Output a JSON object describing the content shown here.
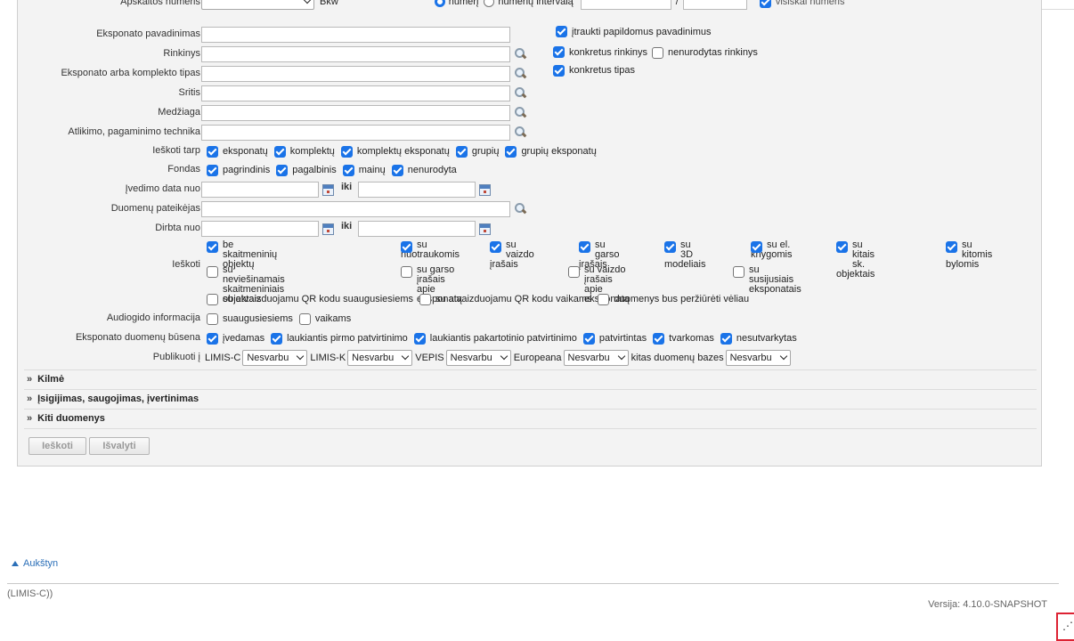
{
  "top_row": {
    "label": "Apskaitos numeris",
    "select_value": "Bkw",
    "radio1": "numerį",
    "radio2": "numerių intervalą",
    "sep": "/",
    "extra": "visiškai numeris"
  },
  "fields": {
    "name": {
      "label": "Eksponato pavadinimas",
      "opt": "įtraukti papildomus pavadinimus"
    },
    "collections": {
      "label": "Rinkinys",
      "opt1": "konkretus rinkinys",
      "opt2": "nenurodytas rinkinys"
    },
    "type": {
      "label": "Eksponato arba komplekto tipas",
      "opt": "konkretus tipas"
    },
    "field": {
      "label": "Sritis"
    },
    "material": {
      "label": "Medžiaga"
    },
    "technique": {
      "label": "Atlikimo, pagaminimo technika"
    }
  },
  "search_among": {
    "label": "Ieškoti tarp",
    "items": [
      "eksponatų",
      "komplektų",
      "komplektų eksponatų",
      "grupių",
      "grupių eksponatų"
    ]
  },
  "fund": {
    "label": "Fondas",
    "items": [
      "pagrindinis",
      "pagalbinis",
      "mainų",
      "nenurodyta"
    ]
  },
  "entry_date": {
    "label": "Įvedimo data nuo",
    "iki": "iki"
  },
  "provider": {
    "label": "Duomenų pateikėjas"
  },
  "made_from": {
    "label": "Dirbta nuo",
    "iki": "iki"
  },
  "search": {
    "label": "Ieškoti",
    "row1": [
      {
        "l1": "be skaitmeninių objektų",
        "l2": "",
        "on": true
      },
      {
        "l1": "su",
        "l2": "nuotraukomis",
        "on": true
      },
      {
        "l1": "su vaizdo",
        "l2": "įrašais",
        "on": true
      },
      {
        "l1": "su garso",
        "l2": "įrašais",
        "on": true
      },
      {
        "l1": "su 3D",
        "l2": "modeliais",
        "on": true
      },
      {
        "l1": "su el.",
        "l2": "knygomis",
        "on": true
      },
      {
        "l1": "su kitais sk.",
        "l2": "objektais",
        "on": true
      },
      {
        "l1": "su kitomis",
        "l2": "bylomis",
        "on": true
      }
    ],
    "row2": [
      {
        "l1": "su neviešinamais skaitmeniniais",
        "l2": "objektais"
      },
      {
        "l1": "su garso įrašais apie eksponatą",
        "l2": ""
      },
      {
        "l1": "su vaizdo įrašais apie eksponatą",
        "l2": ""
      },
      {
        "l1": "su susijusiais eksponatais",
        "l2": ""
      }
    ],
    "row3": [
      "su atvaizduojamu QR kodu suaugusiesiems",
      "su atvaizduojamu QR kodu vaikams",
      "duomenys bus peržiūrėti vėliau"
    ]
  },
  "audioguide": {
    "label": "Audiogido informacija",
    "items": [
      "suaugusiesiems",
      "vaikams"
    ]
  },
  "status": {
    "label": "Eksponato duomenų būsena",
    "items": [
      "įvedamas",
      "laukiantis pirmo patvirtinimo",
      "laukiantis pakartotinio patvirtinimo",
      "patvirtintas",
      "tvarkomas",
      "nesutvarkytas"
    ]
  },
  "publish": {
    "label": "Publikuoti į",
    "targets": [
      {
        "name": "LIMIS-C",
        "value": "Nesvarbu"
      },
      {
        "name": "LIMIS-K",
        "value": "Nesvarbu"
      },
      {
        "name": "VEPIS",
        "value": "Nesvarbu"
      },
      {
        "name": "Europeana",
        "value": "Nesvarbu"
      },
      {
        "name": "kitas duomenų bazes",
        "value": "Nesvarbu"
      }
    ]
  },
  "sections": [
    "Kilmė",
    "Įsigijimas, saugojimas, įvertinimas",
    "Kiti duomenys"
  ],
  "section_arrow": "»",
  "buttons": {
    "search": "Ieškoti",
    "clear": "Išvalyti"
  },
  "footer": {
    "up": "Aukštyn",
    "left": "(LIMIS-C))",
    "version": "Versija: 4.10.0-SNAPSHOT"
  },
  "colors": {
    "checkbox": "#1a73e8",
    "link": "#2b6fb8",
    "panel": "#f3f3f3"
  }
}
